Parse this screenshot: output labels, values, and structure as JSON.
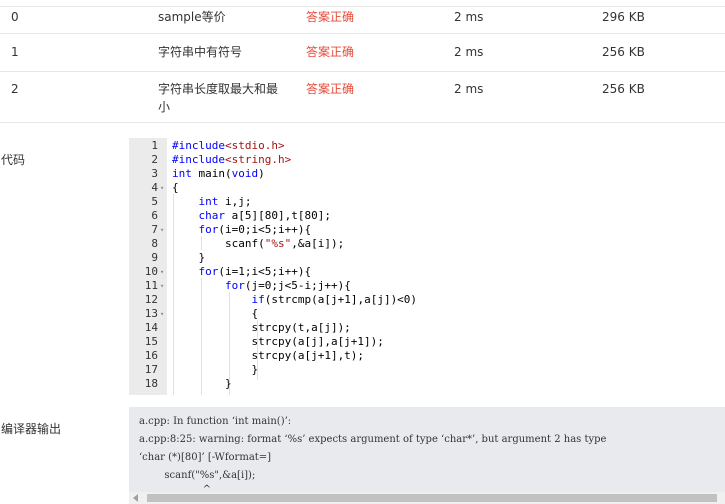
{
  "results": [
    {
      "id": "0",
      "name": "sample等价",
      "status": "答案正确",
      "time": "2 ms",
      "memory": "296 KB"
    },
    {
      "id": "1",
      "name": "字符串中有符号",
      "status": "答案正确",
      "time": "2 ms",
      "memory": "256 KB"
    },
    {
      "id": "2",
      "name_line1": "字符串长度取最大和最",
      "name_line2": "小",
      "status": "答案正确",
      "time": "2 ms",
      "memory": "256 KB"
    }
  ],
  "labels": {
    "code": "代码",
    "compiler": "编译器输出"
  },
  "code_lines": [
    {
      "n": "1",
      "text": "#include<stdio.h>"
    },
    {
      "n": "2",
      "text": "#include<string.h>"
    },
    {
      "n": "3",
      "text": "int main(void)"
    },
    {
      "n": "4",
      "text": "{"
    },
    {
      "n": "5",
      "text": "    int i,j;"
    },
    {
      "n": "6",
      "text": "    char a[5][80],t[80];"
    },
    {
      "n": "7",
      "text": "    for(i=0;i<5;i++){"
    },
    {
      "n": "8",
      "text": "        scanf(\"%s\",&a[i]);"
    },
    {
      "n": "9",
      "text": "    }"
    },
    {
      "n": "10",
      "text": "    for(i=1;i<5;i++){"
    },
    {
      "n": "11",
      "text": "        for(j=0;j<5-i;j++){"
    },
    {
      "n": "12",
      "text": "            if(strcmp(a[j+1],a[j])<0)"
    },
    {
      "n": "13",
      "text": "            {"
    },
    {
      "n": "14",
      "text": "            strcpy(t,a[j]);"
    },
    {
      "n": "15",
      "text": "            strcpy(a[j],a[j+1]);"
    },
    {
      "n": "16",
      "text": "            strcpy(a[j+1],t);"
    },
    {
      "n": "17",
      "text": "            }"
    },
    {
      "n": "18",
      "text": "        }"
    }
  ],
  "compiler_output": [
    "a.cpp: In function ‘int main()’:",
    "a.cpp:8:25: warning: format ‘%s’ expects argument of type ‘char*’, but argument 2 has type",
    "‘char (*)[80]’ [-Wformat=]",
    "        scanf(\"%s\",&a[i]);",
    "                    ^"
  ],
  "colors": {
    "status_ok": "#e74c3c",
    "keyword": "#0000ff",
    "string": "#a31515",
    "gutter_bg": "#ebebeb",
    "compiler_bg": "#e8eaee"
  }
}
